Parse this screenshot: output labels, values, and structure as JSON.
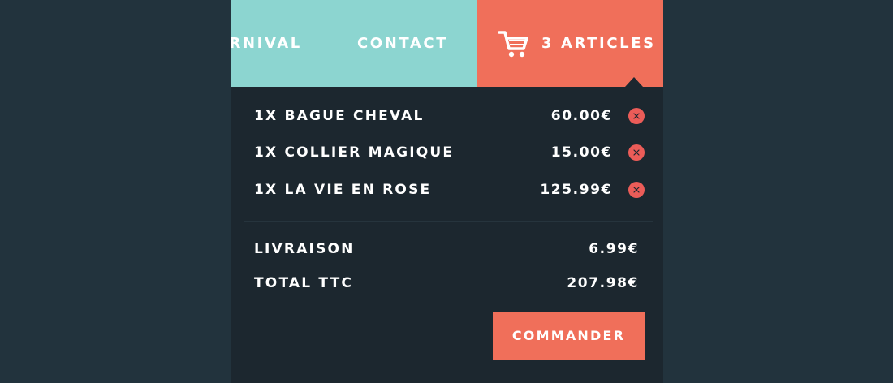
{
  "nav": {
    "links": [
      {
        "label": "ARNIVAL"
      },
      {
        "label": "CONTACT"
      }
    ],
    "cart": {
      "icon": "shopping-cart-icon",
      "label": "3 ARTICLES"
    }
  },
  "cart_dropdown": {
    "items": [
      {
        "name": "1X BAGUE CHEVAL",
        "price": "60.00€",
        "remove_icon": "close-icon"
      },
      {
        "name": "1X COLLIER MAGIQUE",
        "price": "15.00€",
        "remove_icon": "close-icon"
      },
      {
        "name": "1X LA VIE EN ROSE",
        "price": "125.99€",
        "remove_icon": "close-icon"
      }
    ],
    "shipping": {
      "label": "LIVRAISON",
      "value": "6.99€"
    },
    "total": {
      "label": "TOTAL TTC",
      "value": "207.98€"
    },
    "order_button": "COMMANDER"
  },
  "colors": {
    "page_bg": "#22333d",
    "panel_bg": "#1c272f",
    "nav_bg": "#8cd5d0",
    "accent": "#f06f5a",
    "remove": "#eb5c58"
  }
}
